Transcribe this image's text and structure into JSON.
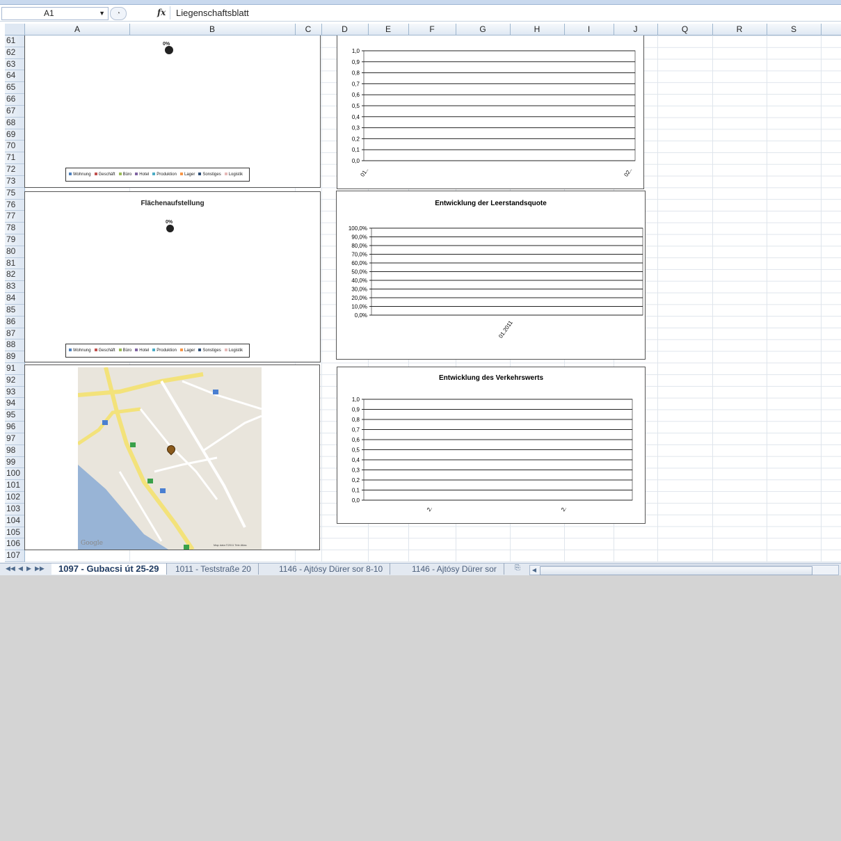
{
  "formula_bar": {
    "name_box": "A1",
    "fx_label": "fx",
    "content": "Liegenschaftsblatt"
  },
  "columns": [
    "A",
    "B",
    "C",
    "D",
    "E",
    "F",
    "G",
    "H",
    "I",
    "J",
    "Q",
    "R",
    "S"
  ],
  "rows": [
    "61",
    "62",
    "63",
    "64",
    "65",
    "66",
    "67",
    "68",
    "69",
    "70",
    "71",
    "72",
    "73",
    "75",
    "76",
    "77",
    "78",
    "79",
    "80",
    "81",
    "82",
    "83",
    "84",
    "85",
    "86",
    "87",
    "88",
    "89",
    "91",
    "92",
    "93",
    "94",
    "95",
    "96",
    "97",
    "98",
    "99",
    "100",
    "101",
    "102",
    "103",
    "104",
    "105",
    "106",
    "107"
  ],
  "pie_chart_top": {
    "percent_label": "0%",
    "legend": [
      "Wohnung",
      "Geschäft",
      "Büro",
      "Hotel",
      "Produktion",
      "Lager",
      "Sonstiges",
      "Logistik"
    ],
    "legend_colors": [
      "#4f81bd",
      "#c0504d",
      "#9bbb59",
      "#8064a2",
      "#4bacc6",
      "#f79646",
      "#2c4d75",
      "#e6b9b8"
    ]
  },
  "pie_chart_area": {
    "title": "Flächenaufstellung",
    "percent_label": "0%",
    "legend": [
      "Wohnung",
      "Geschäft",
      "Büro",
      "Hotel",
      "Produktion",
      "Lager",
      "Sonstiges",
      "Logistik"
    ]
  },
  "chart_data": [
    {
      "type": "line",
      "title": "",
      "yticks": [
        "1,0",
        "0,9",
        "0,8",
        "0,7",
        "0,6",
        "0,5",
        "0,4",
        "0,3",
        "0,2",
        "0,1",
        "0,0"
      ],
      "ylim": [
        0,
        1
      ],
      "categories": [
        "01..",
        "02.."
      ],
      "grid": true
    },
    {
      "type": "line",
      "title": "Entwicklung der Leerstandsquote",
      "yticks": [
        "100,0%",
        "90,0%",
        "80,0%",
        "70,0%",
        "60,0%",
        "50,0%",
        "40,0%",
        "30,0%",
        "20,0%",
        "10,0%",
        "0,0%"
      ],
      "ylim": [
        0,
        100
      ],
      "categories": [
        "01.2011"
      ],
      "grid": true
    },
    {
      "type": "line",
      "title": "Entwicklung des Verkehrswerts",
      "yticks": [
        "1,0",
        "0,9",
        "0,8",
        "0,7",
        "0,6",
        "0,5",
        "0,4",
        "0,3",
        "0,2",
        "0,1",
        "0,0"
      ],
      "ylim": [
        0,
        1
      ],
      "categories": [
        "2.",
        "2."
      ],
      "grid": true
    }
  ],
  "map": {
    "attribution": "Map data ©2011 Tele Atlas",
    "logo": "Google",
    "marker_icon": "map-pin-icon"
  },
  "sheet_tabs": {
    "active": "1097 - Gubacsi út 25-29",
    "others": [
      "1011 - Teststraße 20",
      "1146 - Ajtósy Dürer sor 8-10",
      "1146 - Ajtósy Dürer sor"
    ]
  }
}
